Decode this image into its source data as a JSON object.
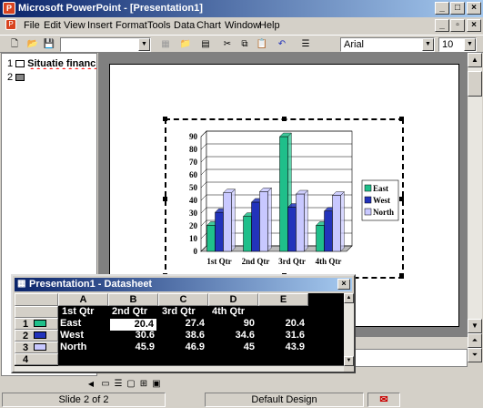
{
  "window": {
    "title": "Microsoft PowerPoint - [Presentation1]",
    "app_icon": "P"
  },
  "menus": [
    "File",
    "Edit",
    "View",
    "Insert",
    "Format",
    "Tools",
    "Data",
    "Chart",
    "Window",
    "Help"
  ],
  "toolbar": {
    "font": "Arial",
    "size": "10"
  },
  "outline": {
    "slide1_num": "1",
    "slide1_title": "Situatie financiara",
    "slide2_num": "2"
  },
  "chart_data": {
    "type": "bar",
    "categories": [
      "1st Qtr",
      "2nd Qtr",
      "3rd Qtr",
      "4th Qtr"
    ],
    "series": [
      {
        "name": "East",
        "values": [
          20.4,
          27.4,
          90,
          20.4
        ],
        "color": "#1fbf8a"
      },
      {
        "name": "West",
        "values": [
          30.6,
          38.6,
          34.6,
          31.6
        ],
        "color": "#2233bb"
      },
      {
        "name": "North",
        "values": [
          45.9,
          46.9,
          45,
          43.9
        ],
        "color": "#c8c8ff"
      }
    ],
    "ylim": [
      0,
      90
    ],
    "yticks": [
      "0",
      "10",
      "20",
      "30",
      "40",
      "50",
      "60",
      "70",
      "80",
      "90"
    ],
    "legend_position": "right",
    "grid": true
  },
  "datasheet": {
    "title": "Presentation1 - Datasheet",
    "columns": [
      "A",
      "B",
      "C",
      "D",
      "E"
    ],
    "header_row": [
      "1st Qtr",
      "2nd Qtr",
      "3rd Qtr",
      "4th Qtr"
    ],
    "rows": [
      {
        "num": "1",
        "label": "East",
        "values": [
          "20.4",
          "27.4",
          "90",
          "20.4"
        ]
      },
      {
        "num": "2",
        "label": "West",
        "values": [
          "30.6",
          "38.6",
          "34.6",
          "31.6"
        ]
      },
      {
        "num": "3",
        "label": "North",
        "values": [
          "45.9",
          "46.9",
          "45",
          "43.9"
        ]
      },
      {
        "num": "4",
        "label": "",
        "values": [
          "",
          "",
          "",
          ""
        ]
      }
    ]
  },
  "status": {
    "slide": "Slide 2 of 2",
    "design": "Default Design"
  }
}
